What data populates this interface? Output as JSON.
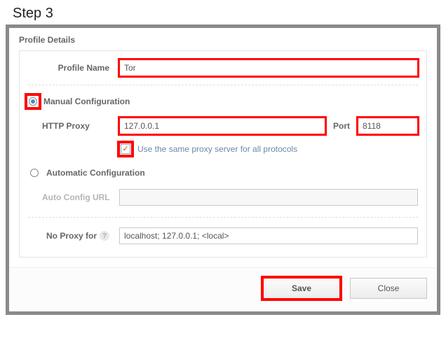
{
  "step_label": "Step 3",
  "fieldset_title": "Profile Details",
  "profile_name": {
    "label": "Profile Name",
    "value": "Tor"
  },
  "config_mode": "manual",
  "manual": {
    "label": "Manual Configuration",
    "http_proxy_label": "HTTP Proxy",
    "http_proxy_value": "127.0.0.1",
    "port_label": "Port",
    "port_value": "8118",
    "same_proxy_checked": true,
    "same_proxy_label": "Use the same proxy server for all protocols"
  },
  "automatic": {
    "label": "Automatic Configuration",
    "auto_url_label": "Auto Config URL",
    "auto_url_value": ""
  },
  "no_proxy": {
    "label": "No Proxy for",
    "value": "localhost; 127.0.0.1; <local>"
  },
  "buttons": {
    "save": "Save",
    "close": "Close"
  }
}
